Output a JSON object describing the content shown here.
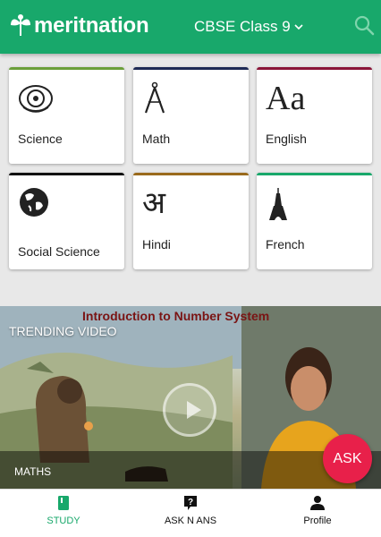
{
  "header": {
    "logo_text": "meritnation",
    "class_selector": "CBSE Class 9",
    "brand_color": "#18a86b"
  },
  "subjects": [
    {
      "label": "Science",
      "icon": "atom-icon",
      "color": "#6a9f3a"
    },
    {
      "label": "Math",
      "icon": "compass-icon",
      "color": "#1e2a55"
    },
    {
      "label": "English",
      "icon": "letters-aa-icon",
      "color": "#8a1538"
    },
    {
      "label": "Social Science",
      "icon": "globe-icon",
      "color": "#111111"
    },
    {
      "label": "Hindi",
      "icon": "hindi-letter-icon",
      "color": "#9a6a1c"
    },
    {
      "label": "French",
      "icon": "eiffel-tower-icon",
      "color": "#18a86b"
    }
  ],
  "icon_glyphs": {
    "english": "Aa",
    "hindi": "अ"
  },
  "video": {
    "title": "Introduction to Number System",
    "section_label": "TRENDING VIDEO",
    "subject": "MATHS",
    "ask_button": "ASK"
  },
  "bottom_nav": [
    {
      "label": "STUDY",
      "icon": "book-icon",
      "active": true
    },
    {
      "label": "ASK N ANS",
      "icon": "question-icon",
      "active": false
    },
    {
      "label": "Profile",
      "icon": "person-icon",
      "active": false
    }
  ]
}
